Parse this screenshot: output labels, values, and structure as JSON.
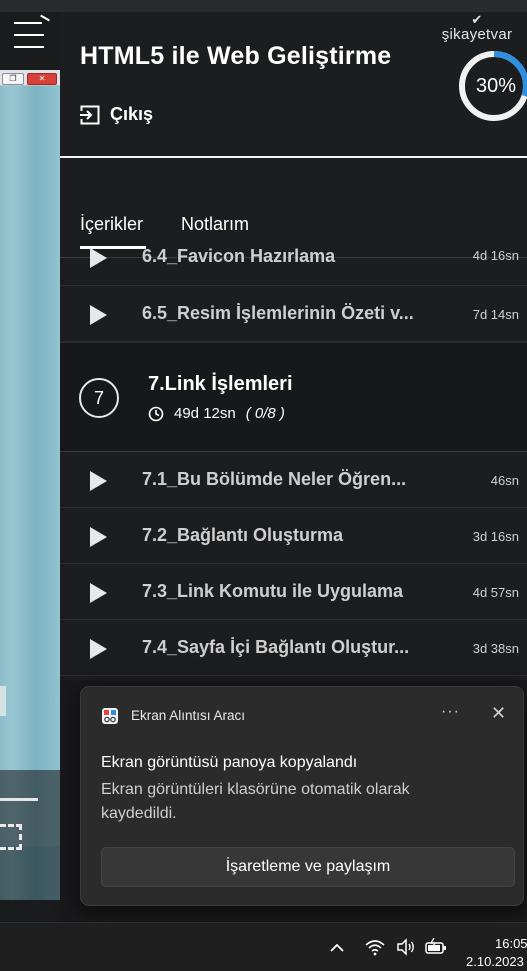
{
  "video": {
    "menu_icon": "hamburger-icon",
    "window_buttons": [
      "restore-icon",
      "close-icon"
    ]
  },
  "header": {
    "course_title": "HTML5 ile Web Geliştirme",
    "exit_label": "Çıkış",
    "brand": "şikayetvar",
    "progress_text": "30%",
    "progress_value": 0.3
  },
  "tabs": {
    "contents": "İçerikler",
    "notes": "Notlarım"
  },
  "lessons_before": [
    {
      "title": "6.4_Favicon Hazırlama",
      "duration": "4d 16sn"
    },
    {
      "title": "6.5_Resim İşlemlerinin Özeti v...",
      "duration": "7d 14sn"
    }
  ],
  "section": {
    "number": "7",
    "title": "7.Link İşlemleri",
    "duration": "49d 12sn",
    "progress": "( 0/8 )"
  },
  "lessons_after": [
    {
      "title": "7.1_Bu Bölümde Neler Öğren...",
      "duration": "46sn"
    },
    {
      "title": "7.2_Bağlantı Oluşturma",
      "duration": "3d 16sn"
    },
    {
      "title": "7.3_Link Komutu ile Uygulama",
      "duration": "4d 57sn"
    },
    {
      "title": "7.4_Sayfa İçi Bağlantı Oluştur...",
      "duration": "3d 38sn"
    }
  ],
  "toast": {
    "app_name": "Ekran Alıntısı Aracı",
    "more": "···",
    "close": "✕",
    "message_title": "Ekran görüntüsü panoya kopyalandı",
    "message_body": "Ekran görüntüleri klasörüne otomatik olarak kaydedildi.",
    "action_label": "İşaretleme ve paylaşım"
  },
  "taskbar": {
    "time": "16:05",
    "date": "2.10.2023"
  },
  "colors": {
    "panel_bg": "#1c1d1f",
    "progress_ring": "#2f8fe0",
    "toast_bg": "#2b2b2b"
  }
}
